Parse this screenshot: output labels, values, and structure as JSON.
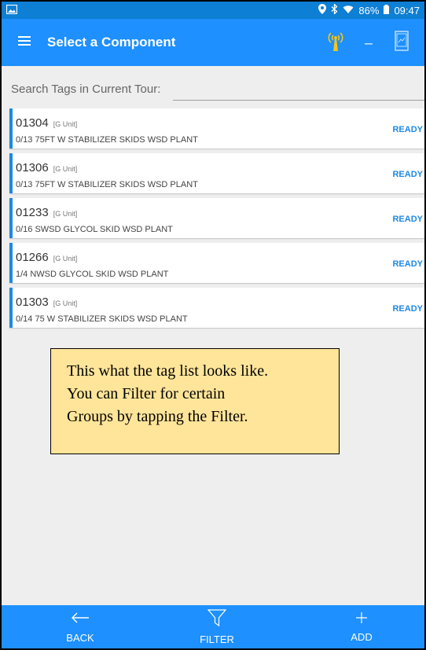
{
  "status_bar": {
    "battery": "86%",
    "time": "09:47"
  },
  "app_bar": {
    "title": "Select a Component"
  },
  "search": {
    "label": "Search Tags in Current Tour:",
    "value": ""
  },
  "tags": [
    {
      "id": "01304",
      "unit": "[G Unit]",
      "desc": "0/13 75FT W STABILIZER SKIDS WSD PLANT",
      "status": "READY"
    },
    {
      "id": "01306",
      "unit": "[G Unit]",
      "desc": "0/13 75FT W STABILIZER SKIDS WSD PLANT",
      "status": "READY"
    },
    {
      "id": "01233",
      "unit": "[G Unit]",
      "desc": "0/16 SWSD GLYCOL SKID WSD PLANT",
      "status": "READY"
    },
    {
      "id": "01266",
      "unit": "[G Unit]",
      "desc": "1/4 NWSD GLYCOL SKID WSD PLANT",
      "status": "READY"
    },
    {
      "id": "01303",
      "unit": "[G Unit]",
      "desc": "0/14 75 W STABILIZER SKIDS WSD PLANT",
      "status": "READY"
    }
  ],
  "note": {
    "lines": [
      "This what the tag list looks like.",
      "You can Filter for certain",
      "Groups by tapping the Filter."
    ]
  },
  "bottom_nav": {
    "back": "BACK",
    "filter": "FILTER",
    "add": "ADD"
  },
  "colors": {
    "primary": "#1e90ff",
    "status_bar": "#0d7fd4",
    "accent_blue": "#1e88e5",
    "note_bg": "#ffe599",
    "antenna_yellow": "#f5c518"
  },
  "icons": {
    "status_left": "image-icon",
    "status_right": [
      "location-icon",
      "bluetooth-icon",
      "wifi-icon",
      "battery-icon"
    ],
    "menu": "hamburger-icon",
    "antenna": "antenna-icon",
    "minimize": "minus-icon",
    "device": "device-icon",
    "back": "arrow-left-icon",
    "filter": "funnel-icon",
    "add": "plus-icon"
  }
}
